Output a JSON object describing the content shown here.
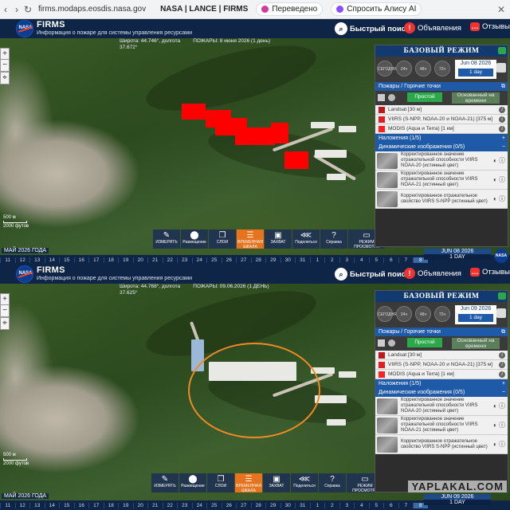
{
  "browser": {
    "url": "firms.modaps.eosdis.nasa.gov",
    "title": "NASA | LANCE | FIRMS",
    "translated": "Переведено",
    "ask": "Спросить Алису AI"
  },
  "header": {
    "logo": "NASA",
    "name": "FIRMS",
    "subtitle": "Информация о пожаре для системы управления ресурсами",
    "search": "Быстрый поиск",
    "ads": "Объявления",
    "reviews": "Отзывы"
  },
  "tools": [
    {
      "label": "ИЗМЕРЯТЬ",
      "icon": "ruler-icon",
      "glyph": "✎"
    },
    {
      "label": "Размещение",
      "icon": "pin-icon",
      "glyph": "⬤"
    },
    {
      "label": "СЛОИ",
      "icon": "layers-icon",
      "glyph": "❐"
    },
    {
      "label": "ВРЕМЕННАЯ ШКАЛА",
      "icon": "sliders-icon",
      "glyph": "☰"
    },
    {
      "label": "ЗАХВАТ",
      "icon": "camera-icon",
      "glyph": "▣"
    },
    {
      "label": "Поделиться",
      "icon": "share-icon",
      "glyph": "⋘"
    },
    {
      "label": "Справка",
      "icon": "help-icon",
      "glyph": "?"
    },
    {
      "label": "РЕЖИМ ПРОСМОТРА",
      "icon": "monitor-icon",
      "glyph": "▭"
    }
  ],
  "panels": [
    {
      "coords": {
        "lat_label": "Широта: 44.746°, долгота",
        "lon": "37.672°",
        "fires": "ПОЖАРЫ: 8 июня 2026 (1 день)"
      },
      "timeline": {
        "month": "МАЙ 2026 ГОДА",
        "days": [
          "11",
          "12",
          "13",
          "14",
          "15",
          "16",
          "17",
          "18",
          "19",
          "20",
          "21",
          "22",
          "23",
          "24",
          "25",
          "26",
          "27",
          "28",
          "29",
          "30",
          "31",
          "1",
          "2",
          "3",
          "4",
          "5",
          "6",
          "7",
          "8"
        ],
        "selected": "8",
        "date": "JUN 08 2026",
        "range": "1 DAY"
      },
      "scale": {
        "m": "500 м",
        "ft": "2000 футов"
      },
      "side_title": "БАЗОВЫЙ РЕЖИМ",
      "date": "Jun 08 2026",
      "range": "1 day",
      "circles": [
        "СЕГОДНЯ",
        "24ч",
        "48ч",
        "72ч"
      ],
      "fires_header": "Пожары / Горячие точки",
      "tab_simple": "Простой",
      "tab_time": "Основанный на времени",
      "layers": [
        {
          "name": "Landsat [30 м]",
          "color": "#c01818"
        },
        {
          "name": "VIIRS (S-NPP, NOAA-20 и NOAA-21) [375 м]",
          "color": "#e02020"
        },
        {
          "name": "MODIS (Аqua и Terra) [1 км]",
          "color": "#ff2020"
        }
      ],
      "overlays": "Наложения (1/5)",
      "dynamic": "Динамические изображения (0/5)",
      "images": [
        "Корректированное значение отражательной способности VIIRS NOAA-20 (истинный цвет)",
        "Корректированное значение отражательной способности VIIRS NOAA-21 (истинный цвет)",
        "Корректированное отражательное свойство VIIRS S-NPP (истинный цвет)"
      ]
    },
    {
      "coords": {
        "lat_label": "Широта: 44.768°, долгота",
        "lon": "37.625°",
        "fires": "ПОЖАРЫ: 09.06.2026 (1 ДЕНЬ)"
      },
      "timeline": {
        "month": "МАЙ 2026 ГОДА",
        "days": [
          "11",
          "12",
          "13",
          "14",
          "15",
          "16",
          "17",
          "18",
          "19",
          "20",
          "21",
          "22",
          "23",
          "24",
          "25",
          "26",
          "27",
          "28",
          "29",
          "30",
          "31",
          "1",
          "2",
          "3",
          "4",
          "5",
          "6",
          "7",
          "8"
        ],
        "selected": "8",
        "date": "JUN 09 2026",
        "range": "1 DAY"
      },
      "scale": {
        "m": "500 м",
        "ft": "2000 футов"
      },
      "side_title": "БАЗОВЫЙ РЕЖИМ",
      "date": "Jun 09 2026",
      "range": "1 day",
      "circles": [
        "СЕГОДНЯ",
        "24ч",
        "48ч",
        "72ч"
      ],
      "fires_header": "Пожары / Горячие точки",
      "tab_simple": "Простой",
      "tab_time": "Основанный на времени",
      "layers": [
        {
          "name": "Landsat [30 м]",
          "color": "#c01818"
        },
        {
          "name": "VIIRS (S-NPP, NOAA-20 и NOAA-21) [375 м]",
          "color": "#e02020"
        },
        {
          "name": "MODIS (Аqua и Terra) [1 км]",
          "color": "#ff2020"
        }
      ],
      "overlays": "Наложения (1/5)",
      "dynamic": "Динамические изображения (0/5)",
      "images": [
        "Корректированное значение отражательной способности VIIRS NOAA-20 (истинный цвет)",
        "Корректированное значение отражательной способности VIIRS NOAA-21 (истинный цвет)",
        "Корректированное отражательное свойство VIIRS S-NPP (истинный цвет)"
      ]
    }
  ],
  "watermark": "YAPLAKAL.COM",
  "colors": {
    "header": "#0f2547",
    "accent": "#e8731f",
    "fire": "#ff0000",
    "ring": "#f08a24",
    "green": "#2aa84a"
  }
}
